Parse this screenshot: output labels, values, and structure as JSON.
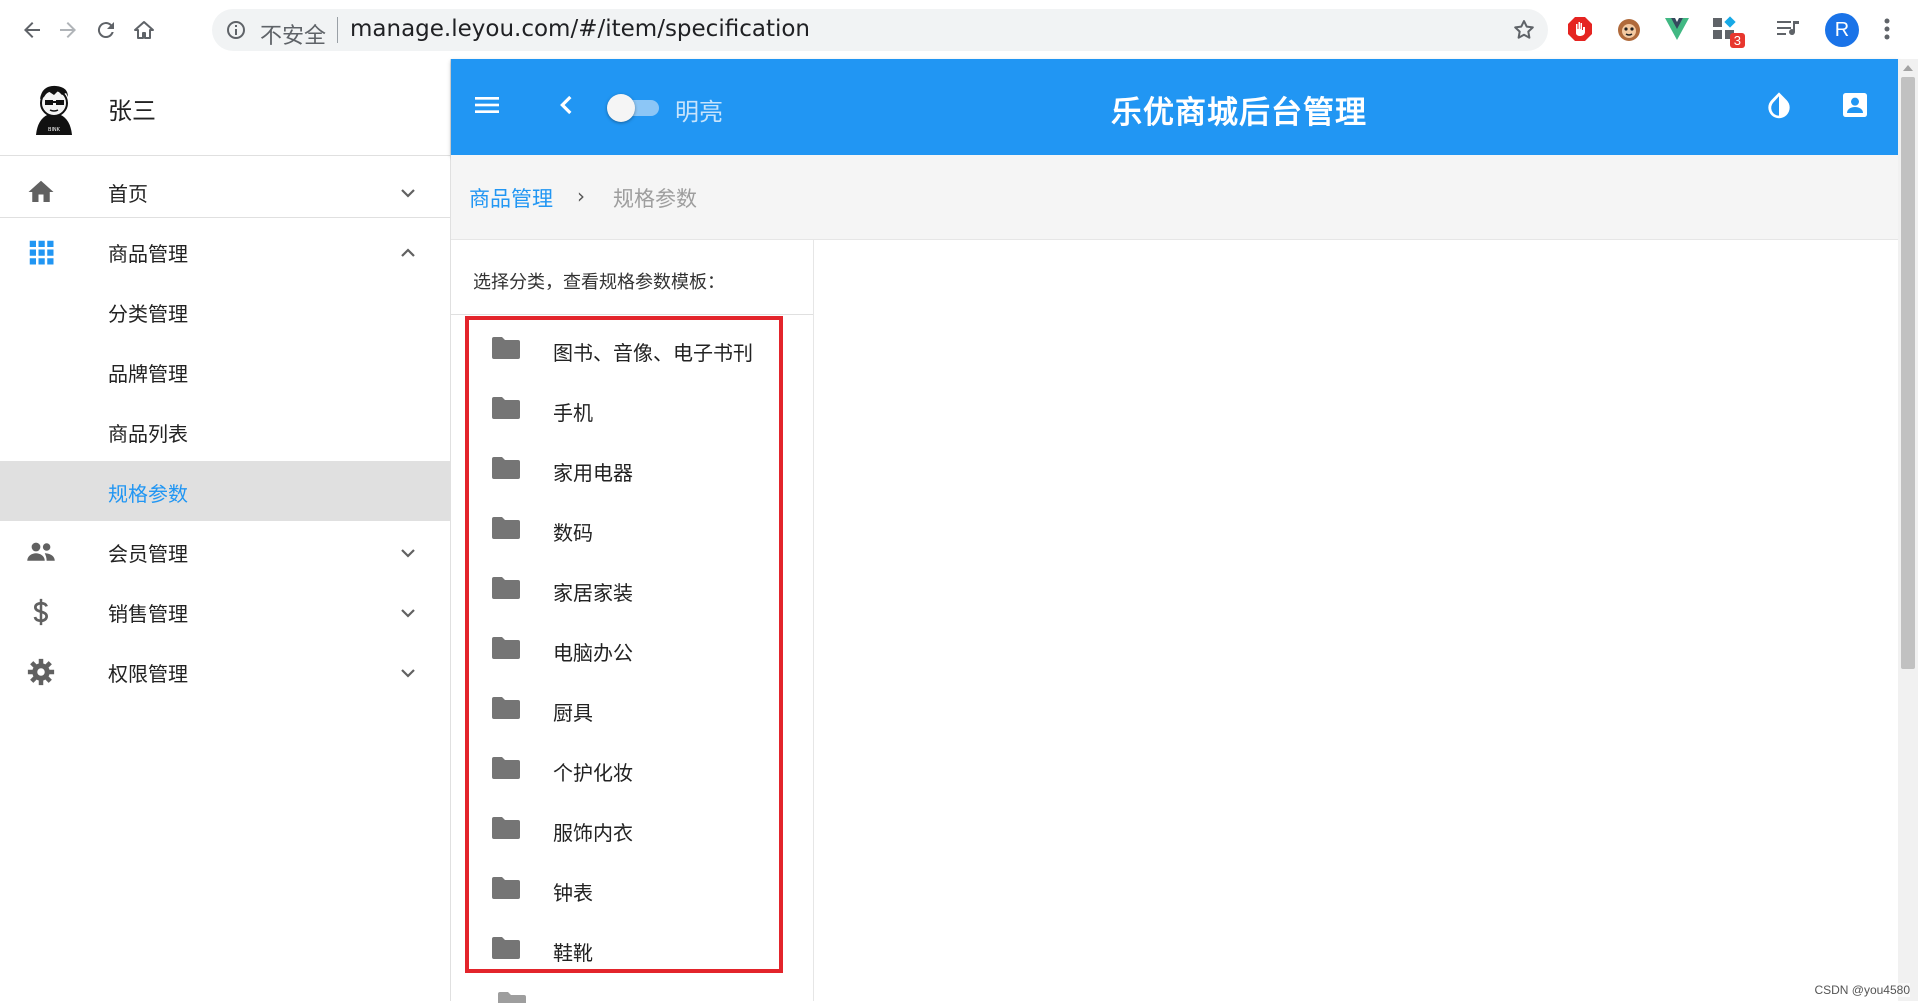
{
  "browser": {
    "security_label": "不安全",
    "url": "manage.leyou.com/#/item/specification",
    "extension_badge": "3",
    "profile_initial": "R"
  },
  "sidebar": {
    "user_name": "张三",
    "items": [
      {
        "label": "首页",
        "icon": "home-icon"
      },
      {
        "label": "商品管理",
        "icon": "apps-grid-icon"
      },
      {
        "label": "会员管理",
        "icon": "people-icon"
      },
      {
        "label": "销售管理",
        "icon": "dollar-icon"
      },
      {
        "label": "权限管理",
        "icon": "gear-icon"
      }
    ],
    "sub_items": [
      {
        "label": "分类管理"
      },
      {
        "label": "品牌管理"
      },
      {
        "label": "商品列表"
      },
      {
        "label": "规格参数",
        "active": true
      }
    ]
  },
  "appbar": {
    "theme_label": "明亮",
    "title": "乐优商城后台管理"
  },
  "breadcrumb": {
    "parent": "商品管理",
    "separator": "›",
    "current": "规格参数"
  },
  "tree": {
    "hint": "选择分类，查看规格参数模板：",
    "nodes": [
      "图书、音像、电子书刊",
      "手机",
      "家用电器",
      "数码",
      "家居家装",
      "电脑办公",
      "厨具",
      "个护化妆",
      "服饰内衣",
      "钟表",
      "鞋靴"
    ]
  },
  "colors": {
    "primary": "#2196f3",
    "highlight_box": "#e3242b",
    "active_bg": "#e0e0e0"
  },
  "watermark": "CSDN @you4580"
}
